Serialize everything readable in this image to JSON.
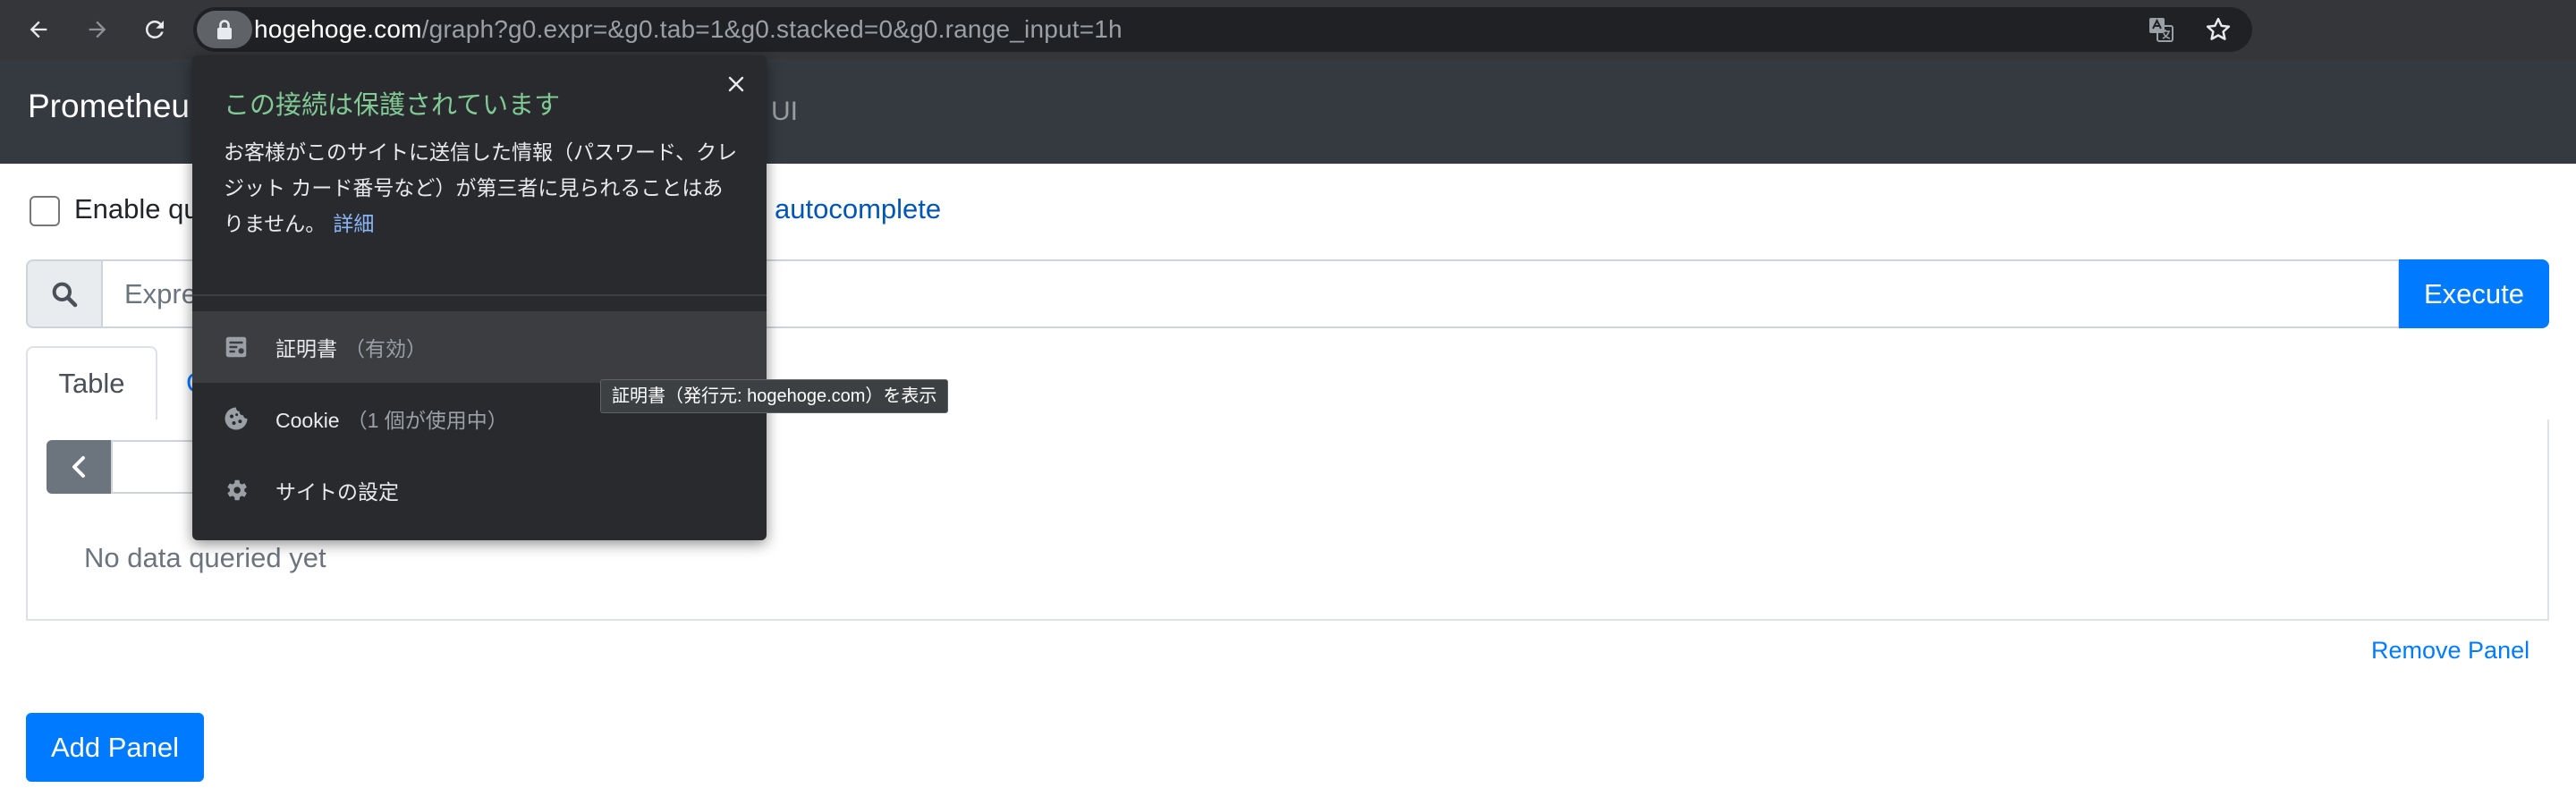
{
  "browser": {
    "url_host": "hogehoge.com",
    "url_path": "/graph?g0.expr=&g0.tab=1&g0.stacked=0&g0.range_input=1h",
    "colors": {
      "chrome": "#35363a",
      "omnibox": "#202124"
    }
  },
  "navbar": {
    "brand": "Prometheu",
    "classic_ui": "ic UI"
  },
  "page": {
    "option_label": "Enable qu",
    "autocomplete_label": "autocomplete",
    "expression_placeholder": "Expre",
    "execute_label": "Execute",
    "tabs": [
      {
        "label": "Table",
        "active": true
      },
      {
        "label": "G",
        "active": false
      }
    ],
    "no_data": "No data queried yet",
    "remove_panel": "Remove Panel",
    "add_panel": "Add Panel",
    "colors": {
      "primary": "#007bff",
      "navbar": "#343a40"
    }
  },
  "site_info_popup": {
    "title": "この接続は保護されています",
    "body": "お客様がこのサイトに送信した情報（パスワード、クレジット カード番号など）が第三者に見られることはありません。",
    "details_link": "詳細",
    "rows": [
      {
        "label": "証明書",
        "sub": "（有効）",
        "icon": "certificate-icon"
      },
      {
        "label": "Cookie",
        "sub": "（1 個が使用中）",
        "icon": "cookie-icon"
      },
      {
        "label": "サイトの設定",
        "sub": "",
        "icon": "gear-icon"
      }
    ],
    "colors": {
      "title": "#81c995",
      "background": "#292a2d",
      "link": "#8ab4f8"
    }
  },
  "tooltip": {
    "text": "証明書（発行元: hogehoge.com）を表示"
  }
}
